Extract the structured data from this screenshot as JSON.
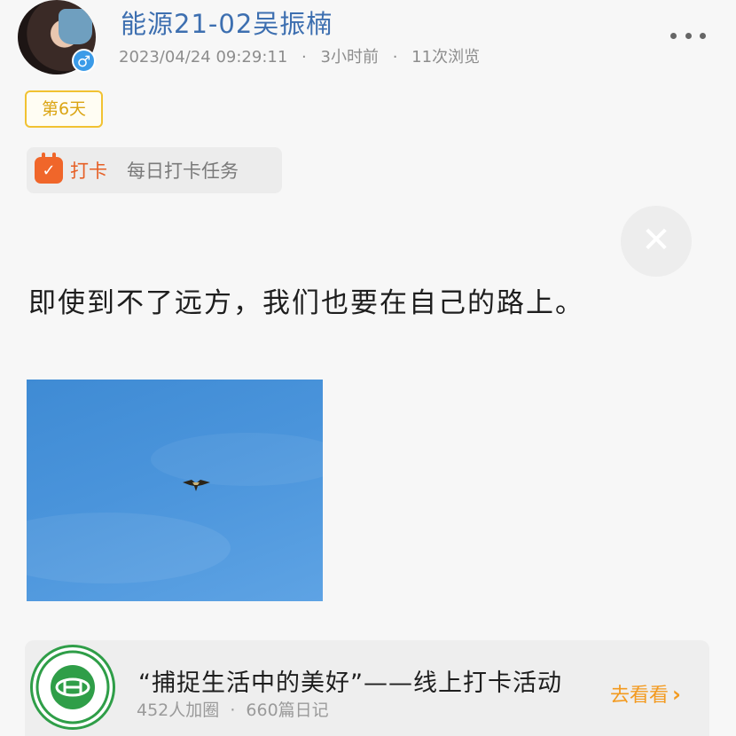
{
  "header": {
    "username": "能源21-02吴振楠",
    "gender_symbol": "♂",
    "datetime": "2023/04/24 09:29:11",
    "time_ago": "3小时前",
    "views": "11次浏览",
    "separator": "·"
  },
  "badge": {
    "day_label": "第6天"
  },
  "checkin": {
    "icon_glyph": "✓",
    "label": "打卡",
    "task": "每日打卡任务"
  },
  "close": {
    "glyph": "✕"
  },
  "post": {
    "text": "即使到不了远方，我们也要在自己的路上。"
  },
  "activity": {
    "title": "“捕捉生活中的美好”——线上打卡活动",
    "members": "452人加圈",
    "separator": "·",
    "diaries": "660篇日记",
    "view_label": "去看看",
    "view_chevron": "›"
  },
  "colors": {
    "username": "#3d6fb0",
    "accent_orange": "#f0662a",
    "badge_gold": "#dba514",
    "sky_blue": "#4a94db",
    "logo_green": "#2f9e48"
  }
}
